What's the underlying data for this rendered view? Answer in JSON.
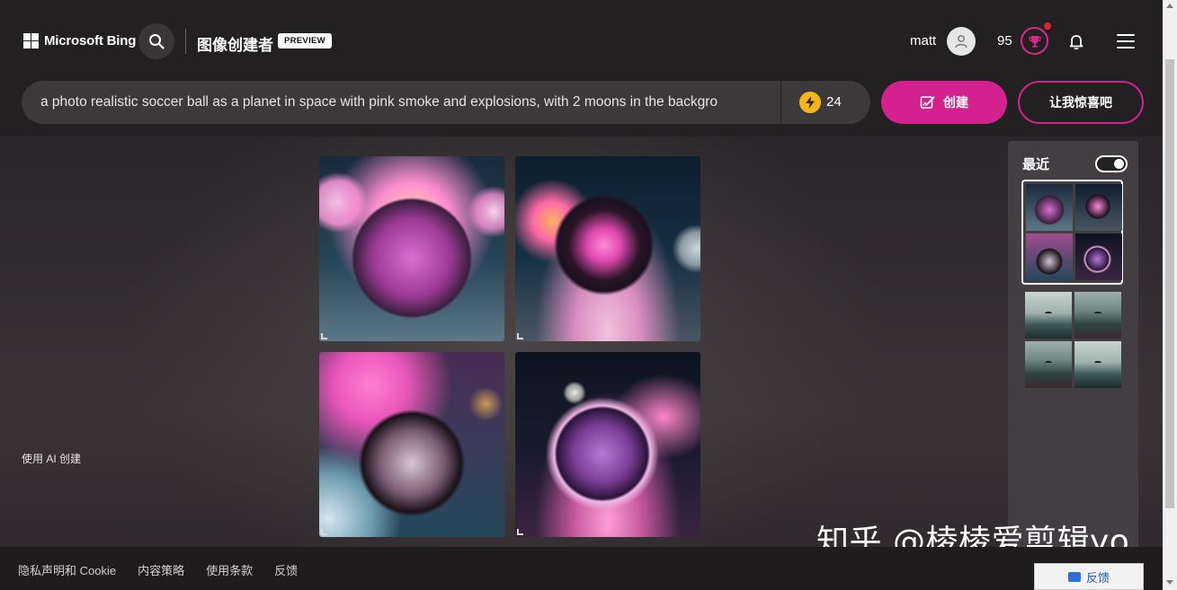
{
  "header": {
    "brand": "Microsoft Bing",
    "app_title": "图像创建者",
    "preview_badge": "PREVIEW",
    "user_name": "matt",
    "points": "95"
  },
  "prompt": {
    "text": "a photo realistic soccer ball as a planet in space with pink smoke and explosions, with 2 moons in the backgro",
    "boosts": "24",
    "create_label": "创建",
    "surprise_label": "让我惊喜吧"
  },
  "results": {
    "images": [
      {
        "name": "soccer-planet-1"
      },
      {
        "name": "soccer-planet-2"
      },
      {
        "name": "soccer-planet-3"
      },
      {
        "name": "soccer-planet-4"
      }
    ],
    "created_with_ai": "使用 AI 创建"
  },
  "recent": {
    "title": "最近",
    "toggle_on": true
  },
  "watermark": "知乎 @棱棱爱剪辑yo",
  "footer": {
    "links": [
      "隐私声明和 Cookie",
      "内容策略",
      "使用条款",
      "反馈"
    ],
    "feedback_button": "反馈"
  },
  "colors": {
    "accent": "#d3228e",
    "boost": "#f4b71b",
    "header_bg": "#232022",
    "footer_bg": "#1e1c1d"
  }
}
